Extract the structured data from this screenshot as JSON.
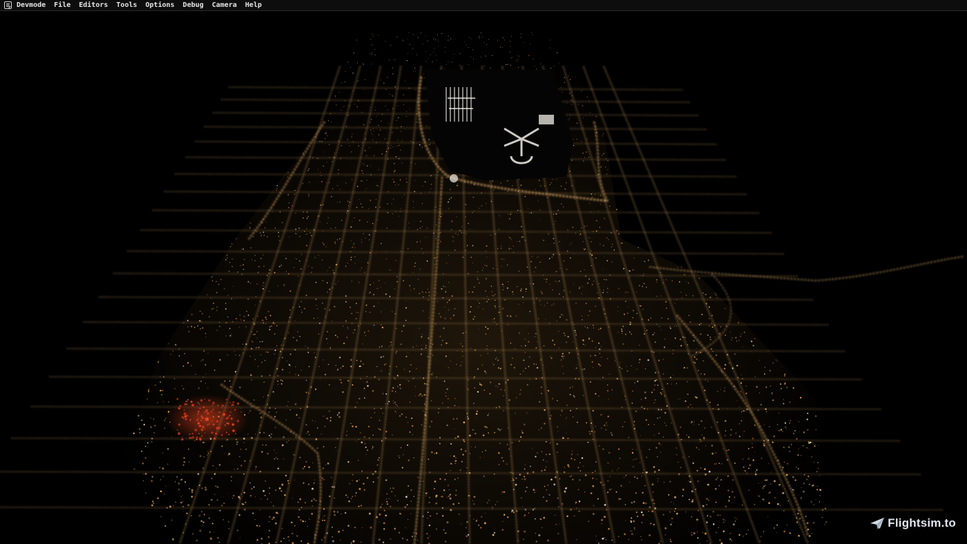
{
  "menubar": {
    "icon": "devmode-editor-icon",
    "items": [
      {
        "label": "Devmode"
      },
      {
        "label": "File"
      },
      {
        "label": "Editors"
      },
      {
        "label": "Tools"
      },
      {
        "label": "Options"
      },
      {
        "label": "Debug"
      },
      {
        "label": "Camera"
      },
      {
        "label": "Help"
      }
    ]
  },
  "scene": {
    "description_icon": "night-city-aerial-view",
    "colors": {
      "background": "#000000",
      "street_light": "#e8b36a",
      "warm_glow": "#c9893d",
      "red_lights": "#d83a1e",
      "airport_white": "#f2efe6"
    }
  },
  "watermark": {
    "icon": "paper-plane-icon",
    "text": "Flightsim.to",
    "color": "#dfe6ee"
  }
}
